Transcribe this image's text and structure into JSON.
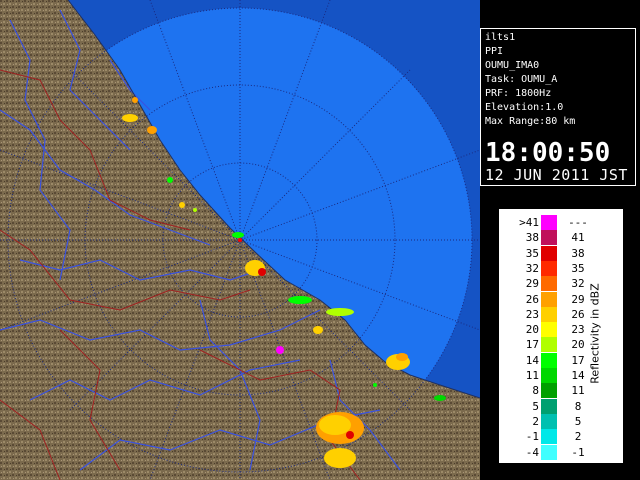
{
  "info": {
    "station": "ilts1",
    "product": "PPI",
    "site": "OUMU_IMA0",
    "task": "Task: OUMU_A",
    "prf": "PRF: 1800Hz",
    "elevation": "Elevation:1.0",
    "max_range": "Max Range:80 km",
    "time": "18:00:50",
    "date": "12 JUN 2011 JST"
  },
  "legend": {
    "title": "Reflectivity in dBZ",
    "rows": [
      {
        "lo": ">41",
        "hi": "---",
        "color": "#ff00ff"
      },
      {
        "lo": "38",
        "hi": "41",
        "color": "#c0105a"
      },
      {
        "lo": "35",
        "hi": "38",
        "color": "#e00000"
      },
      {
        "lo": "32",
        "hi": "35",
        "color": "#ff2a00"
      },
      {
        "lo": "29",
        "hi": "32",
        "color": "#ff6a00"
      },
      {
        "lo": "26",
        "hi": "29",
        "color": "#ffa000"
      },
      {
        "lo": "23",
        "hi": "26",
        "color": "#ffd000"
      },
      {
        "lo": "20",
        "hi": "23",
        "color": "#ffff00"
      },
      {
        "lo": "17",
        "hi": "20",
        "color": "#b0ff00"
      },
      {
        "lo": "14",
        "hi": "17",
        "color": "#00ff00"
      },
      {
        "lo": "11",
        "hi": "14",
        "color": "#00d800"
      },
      {
        "lo": "8",
        "hi": "11",
        "color": "#00a000"
      },
      {
        "lo": "5",
        "hi": "8",
        "color": "#00a070"
      },
      {
        "lo": "2",
        "hi": "5",
        "color": "#00c0b0"
      },
      {
        "lo": "-1",
        "hi": "2",
        "color": "#00e8e8"
      },
      {
        "lo": "-4",
        "hi": "-1",
        "color": "#40ffff"
      }
    ]
  },
  "colors": {
    "sea": "#1e73f0",
    "sea_outer": "#1553c4",
    "land": "#7a6a4e",
    "rivers": "#3a52e0",
    "boundaries": "#a02020",
    "range_rings": "#1a2a80"
  }
}
